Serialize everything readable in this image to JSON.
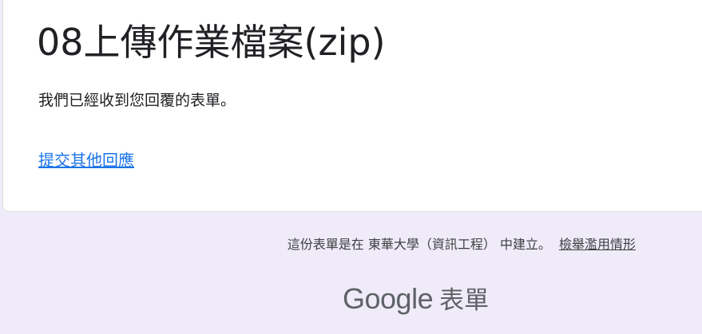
{
  "form": {
    "title": "08上傳作業檔案(zip)",
    "confirmation_message": "我們已經收到您回覆的表單。",
    "submit_another_link": "提交其他回應"
  },
  "footer": {
    "created_in": "這份表單是在 東華大學（資訊工程） 中建立。",
    "report_abuse": "檢舉濫用情形"
  },
  "brand": {
    "google": "Google",
    "product": "表單"
  },
  "colors": {
    "background": "#f0ebf8",
    "card": "#ffffff",
    "link": "#1a73e8",
    "text": "#202124",
    "muted": "#5f6368"
  }
}
